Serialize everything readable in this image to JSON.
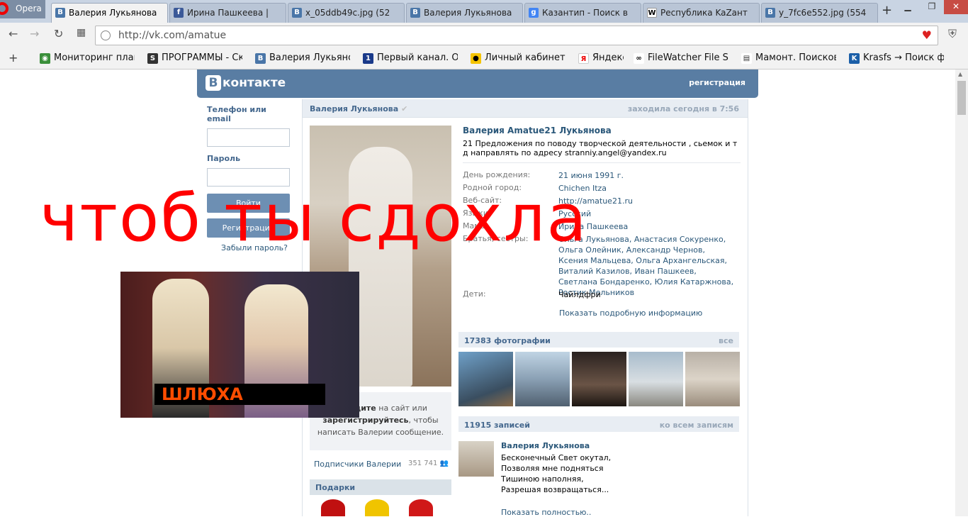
{
  "browser": {
    "app_name": "Opera",
    "tabs": [
      {
        "label": "Валерия Лукьянова",
        "icon": "vk-icon",
        "active": true
      },
      {
        "label": "Ирина Пашкеева |",
        "icon": "facebook-icon"
      },
      {
        "label": "x_05ddb49c.jpg (52",
        "icon": "vk-icon"
      },
      {
        "label": "Валерия Лукьянова",
        "icon": "vk-icon"
      },
      {
        "label": "Казантип - Поиск в",
        "icon": "google-icon"
      },
      {
        "label": "Республика KaZант",
        "icon": "wikipedia-icon"
      },
      {
        "label": "y_7fc6e552.jpg (554",
        "icon": "vk-icon"
      }
    ],
    "url": "http://vk.com/amatue",
    "bookmarks": [
      {
        "label": "Мониторинг плане",
        "icon": "globe-icon"
      },
      {
        "label": "ПРОГРАММЫ - Ска",
        "icon": "s-icon"
      },
      {
        "label": "Валерия Лукьянова",
        "icon": "vk-icon"
      },
      {
        "label": "Первый канал. Офи",
        "icon": "channel-one-icon"
      },
      {
        "label": "Личный кабинет мо",
        "icon": "beeline-icon"
      },
      {
        "label": "Яндекс",
        "icon": "yandex-icon"
      },
      {
        "label": "FileWatcher File Sea",
        "icon": "filewatcher-icon"
      },
      {
        "label": "Мамонт. Поисковая",
        "icon": "document-icon"
      },
      {
        "label": "Krasfs → Поиск фа",
        "icon": "krasfs-icon"
      }
    ]
  },
  "vk": {
    "logo_text": "контакте",
    "register_link": "регистрация",
    "login": {
      "phone_label": "Телефон или email",
      "password_label": "Пароль",
      "login_button": "Войти",
      "register_button": "Регистрация",
      "forgot": "Забыли пароль?"
    },
    "profile": {
      "header_name": "Валерия Лукьянова",
      "last_seen": "заходила сегодня в 7:56",
      "full_name": "Валерия Amatue21 Лукьянова",
      "status": "21 Предложения по поводу творческой деятельности , сьемок и т д направлять по адресу stranniy.angel@yandex.ru",
      "fields": [
        {
          "key": "День рождения:",
          "value": "21 июня 1991 г."
        },
        {
          "key": "Родной город:",
          "value": "Chichen Itza"
        },
        {
          "key": "Веб-сайт:",
          "value": "http://amatue21.ru"
        },
        {
          "key": "Языки:",
          "value": "Русский"
        },
        {
          "key": "Мама:",
          "value": "Ирина Пашкеева"
        },
        {
          "key": "Братья, сестры:",
          "value": "Ольга Лукьянова, Анастасия Сокуренко, Ольга Олейник, Александр Чернов, Ксения Мальцева, Ольга Архангельская, Виталий Казилов, Иван Пашкеев, Светлана Бондаренко, Юлия Катаржнова, Ростик Мельников"
        },
        {
          "key": "Дети:",
          "value": "Чайлдфри"
        }
      ],
      "show_more": "Показать подробную информацию",
      "message_box": {
        "pre": ", ",
        "login_word": "войдите",
        "mid": " на сайт или ",
        "register_word": "зарегистрируйтесь",
        "post": ", чтобы написать Валерии сообщение."
      },
      "subscribers_label": "Подписчики Валерии",
      "subscribers_count": "351 741",
      "gifts_label": "Подарки",
      "photos_label": "17383 фотографии",
      "photos_all": "все",
      "posts_label": "11915 записей",
      "posts_all": "ко всем записям",
      "post": {
        "author": "Валерия Лукьянова",
        "lines": [
          "Бесконечный Свет окутал,",
          "Позволяя мне подняться",
          "Тишиною наполняя,",
          "Разрешая возвращаться..."
        ],
        "show_full": "Показать полностью.."
      }
    }
  },
  "overlay": {
    "text": "чтоб ты сдохла",
    "caption": "ШЛЮХА",
    "text_color": "#ff0000",
    "caption_color": "#ff4d00"
  },
  "colors": {
    "vk_blue": "#597da3",
    "link": "#2b587a"
  }
}
